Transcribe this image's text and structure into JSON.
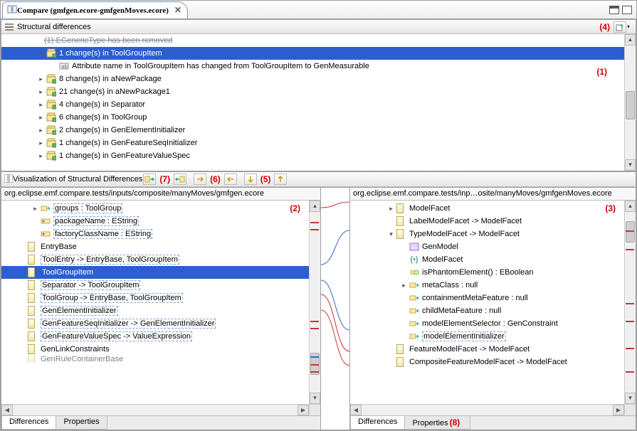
{
  "window": {
    "title": "Compare (gmfgen.ecore-gmfgenMoves.ecore)"
  },
  "annotations": {
    "a1": "(1)",
    "a2": "(2)",
    "a3": "(3)",
    "a4": "(4)",
    "a5": "(5)",
    "a6": "(6)",
    "a7": "(7)",
    "a8": "(8)"
  },
  "diff_section": {
    "title": "Structural differences",
    "ghost_row": "(1) EGenericType has been removed",
    "rows": [
      {
        "indent": 1,
        "expander": "▾",
        "icon": "package-icon",
        "label": "1 change(s) in ToolGroupItem",
        "selected": true
      },
      {
        "indent": 2,
        "expander": "",
        "icon": "attr-icon",
        "label": "Attribute name in ToolGroupItem has changed from ToolGroupItem to GenMeasurable",
        "selected": false
      },
      {
        "indent": 1,
        "expander": "▸",
        "icon": "package-icon",
        "label": "8 change(s) in aNewPackage"
      },
      {
        "indent": 1,
        "expander": "▸",
        "icon": "package-icon",
        "label": "21 change(s) in aNewPackage1"
      },
      {
        "indent": 1,
        "expander": "▸",
        "icon": "package-icon",
        "label": "4 change(s) in Separator"
      },
      {
        "indent": 1,
        "expander": "▸",
        "icon": "package-icon",
        "label": "6 change(s) in ToolGroup"
      },
      {
        "indent": 1,
        "expander": "▸",
        "icon": "package-icon",
        "label": "2 change(s) in GenElementInitializer"
      },
      {
        "indent": 1,
        "expander": "▸",
        "icon": "package-icon",
        "label": "1 change(s) in GenFeatureSeqInitializer"
      },
      {
        "indent": 1,
        "expander": "▸",
        "icon": "package-icon",
        "label": "1 change(s) in GenFeatureValueSpec"
      }
    ]
  },
  "viz_section": {
    "title": "Visualization of Structural Differences",
    "left_path": "org.eclipse.emf.compare.tests/inputs/composite/manyMoves/gmfgen.ecore",
    "right_path": "org.eclipse.emf.compare.tests/inp…osite/manyMoves/gmfgenMoves.ecore",
    "left_rows": [
      {
        "indent": 1,
        "expander": "▸",
        "icon": "ref-icon",
        "label": "groups : ToolGroup",
        "box": true
      },
      {
        "indent": 1,
        "expander": "",
        "icon": "attr2-icon",
        "label": "packageName : EString",
        "box": true
      },
      {
        "indent": 1,
        "expander": "",
        "icon": "attr2-icon",
        "label": "factoryClassName : EString",
        "box": true
      },
      {
        "indent": 0,
        "expander": "",
        "icon": "class-icon",
        "label": "EntryBase"
      },
      {
        "indent": 0,
        "expander": "",
        "icon": "class-icon",
        "label": "ToolEntry -> EntryBase, ToolGroupItem",
        "box": true
      },
      {
        "indent": 0,
        "expander": "",
        "icon": "class-icon",
        "label": "ToolGroupItem",
        "box": true,
        "selected": true
      },
      {
        "indent": 0,
        "expander": "",
        "icon": "class-icon",
        "label": "Separator -> ToolGroupItem",
        "box": true
      },
      {
        "indent": 0,
        "expander": "",
        "icon": "class-icon",
        "label": "ToolGroup -> EntryBase, ToolGroupItem",
        "box": true
      },
      {
        "indent": 0,
        "expander": "",
        "icon": "class-icon",
        "label": "GenElementInitializer",
        "box": true
      },
      {
        "indent": 0,
        "expander": "",
        "icon": "class-icon",
        "label": "GenFeatureSeqInitializer -> GenElementInitializer",
        "box": true
      },
      {
        "indent": 0,
        "expander": "",
        "icon": "class-icon",
        "label": "GenFeatureValueSpec -> ValueExpression",
        "box": true
      },
      {
        "indent": 0,
        "expander": "",
        "icon": "class-icon",
        "label": "GenLinkConstraints"
      },
      {
        "indent": 0,
        "expander": "",
        "icon": "class-icon",
        "label": "GenRuleContainerBase",
        "clipped": true
      }
    ],
    "right_rows": [
      {
        "indent": 1,
        "expander": "▸",
        "icon": "class-icon",
        "label": "ModelFacet"
      },
      {
        "indent": 1,
        "expander": "",
        "icon": "class-icon",
        "label": "LabelModelFacet -> ModelFacet"
      },
      {
        "indent": 1,
        "expander": "▾",
        "icon": "class-icon",
        "label": "TypeModelFacet -> ModelFacet"
      },
      {
        "indent": 2,
        "expander": "",
        "icon": "gen-icon",
        "label": "GenModel"
      },
      {
        "indent": 2,
        "expander": "",
        "icon": "paren-icon",
        "label": "ModelFacet"
      },
      {
        "indent": 2,
        "expander": "",
        "icon": "op-icon",
        "label": "isPhantomElement() : EBoolean"
      },
      {
        "indent": 2,
        "expander": "▸",
        "icon": "ref-icon",
        "label": "metaClass : null"
      },
      {
        "indent": 2,
        "expander": "",
        "icon": "ref-icon",
        "label": "containmentMetaFeature : null"
      },
      {
        "indent": 2,
        "expander": "",
        "icon": "ref-icon",
        "label": "childMetaFeature : null"
      },
      {
        "indent": 2,
        "expander": "",
        "icon": "ref-icon",
        "label": "modelElementSelector : GenConstraint"
      },
      {
        "indent": 2,
        "expander": "",
        "icon": "ref-icon",
        "label": "modelElementInitializer",
        "box": true
      },
      {
        "indent": 1,
        "expander": "",
        "icon": "class-icon",
        "label": "FeatureModelFacet -> ModelFacet"
      },
      {
        "indent": 1,
        "expander": "",
        "icon": "class-icon",
        "label": "CompositeFeatureModelFacet -> ModelFacet"
      }
    ],
    "tabs": {
      "diff": "Differences",
      "prop": "Properties"
    }
  }
}
